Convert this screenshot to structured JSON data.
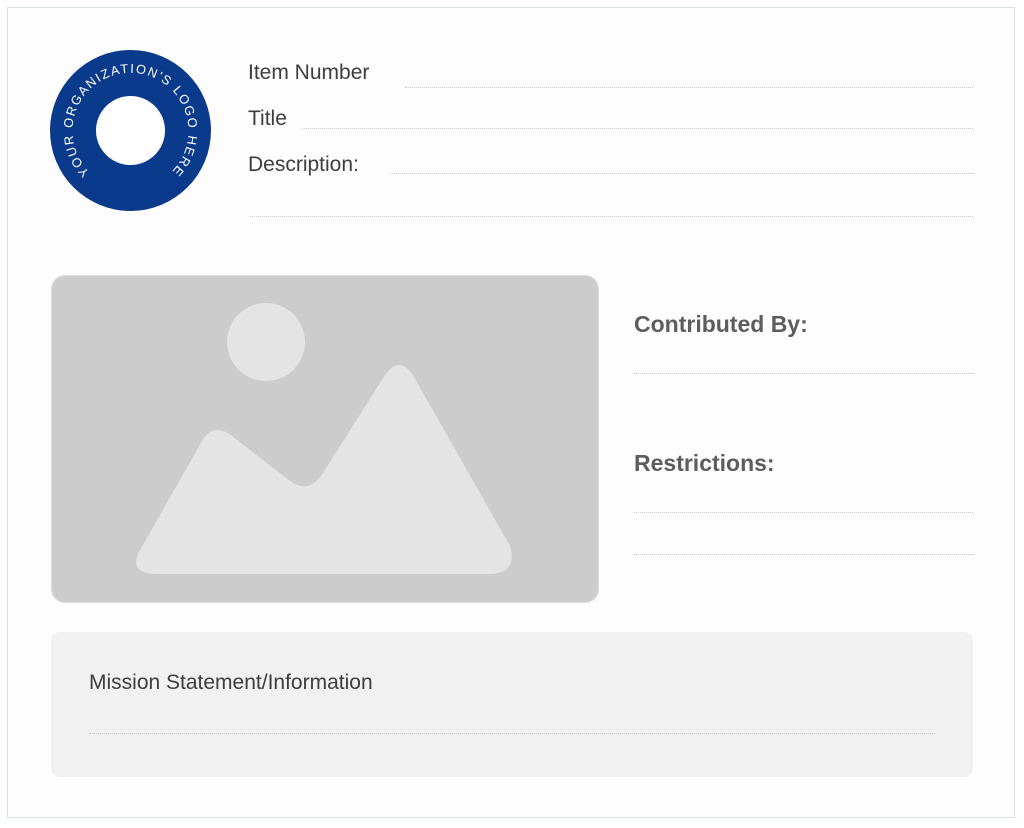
{
  "logo": {
    "text": "YOUR ORGANIZATION'S LOGO HERE",
    "color": "#0a3a8c"
  },
  "fields": {
    "item_number": "Item Number",
    "title": "Title",
    "description": "Description:"
  },
  "photo": {
    "icon": "image-placeholder-icon"
  },
  "side": {
    "contributed_by": "Contributed By:",
    "restrictions": "Restrictions:"
  },
  "mission": {
    "label": "Mission Statement/Information"
  },
  "colors": {
    "brand": "#0a3a8c",
    "photo_bg": "#cccccc",
    "photo_shapes": "#e4e4e4",
    "mission_bg": "#f1f1f1"
  }
}
